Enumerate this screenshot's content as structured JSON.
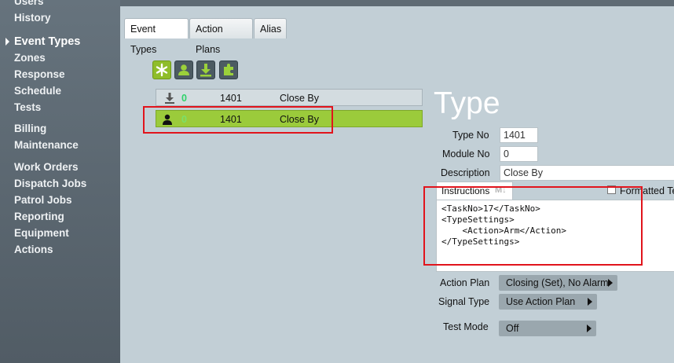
{
  "sidebar": {
    "items": [
      {
        "label": "Users"
      },
      {
        "label": "History"
      },
      {
        "label": "Event Types"
      },
      {
        "label": "Zones"
      },
      {
        "label": "Response"
      },
      {
        "label": "Schedule"
      },
      {
        "label": "Tests"
      },
      {
        "label": "Billing"
      },
      {
        "label": "Maintenance"
      },
      {
        "label": "Work Orders"
      },
      {
        "label": "Dispatch Jobs"
      },
      {
        "label": "Patrol Jobs"
      },
      {
        "label": "Reporting"
      },
      {
        "label": "Equipment"
      },
      {
        "label": "Actions"
      }
    ],
    "active": "Event Types"
  },
  "tabs": [
    {
      "label": "Event Types"
    },
    {
      "label": "Action Plans"
    },
    {
      "label": "Alias"
    }
  ],
  "toolbar": {
    "icons": [
      "asterisk-icon",
      "user-icon",
      "download-icon",
      "plugin-icon"
    ]
  },
  "rows": [
    {
      "icon": "download-icon",
      "count": "0",
      "type_no": "1401",
      "description": "Close By"
    },
    {
      "icon": "user-icon",
      "count": "0",
      "type_no": "1401",
      "description": "Close By"
    }
  ],
  "detail": {
    "heading": "Type",
    "type_no_label": "Type No",
    "type_no_value": "1401",
    "module_no_label": "Module No",
    "module_no_value": "0",
    "description_label": "Description",
    "description_value": "Close By",
    "instructions_tab": "Instructions",
    "markdown_badge": "M↓",
    "formatted_label": "Formatted Te",
    "instructions_text": "<TaskNo>17</TaskNo>\n<TypeSettings>\n    <Action>Arm</Action>\n</TypeSettings>",
    "action_plan_label": "Action Plan",
    "action_plan_value": "Closing (Set), No Alarm",
    "signal_type_label": "Signal Type",
    "signal_type_value": "Use Action Plan",
    "test_mode_label": "Test Mode",
    "test_mode_value": "Off"
  },
  "colors": {
    "accent_green": "#9bcb3b",
    "highlight_red": "#e1141c",
    "sidebar_bg": "#5d6973",
    "page_bg": "#c2cfd6"
  }
}
